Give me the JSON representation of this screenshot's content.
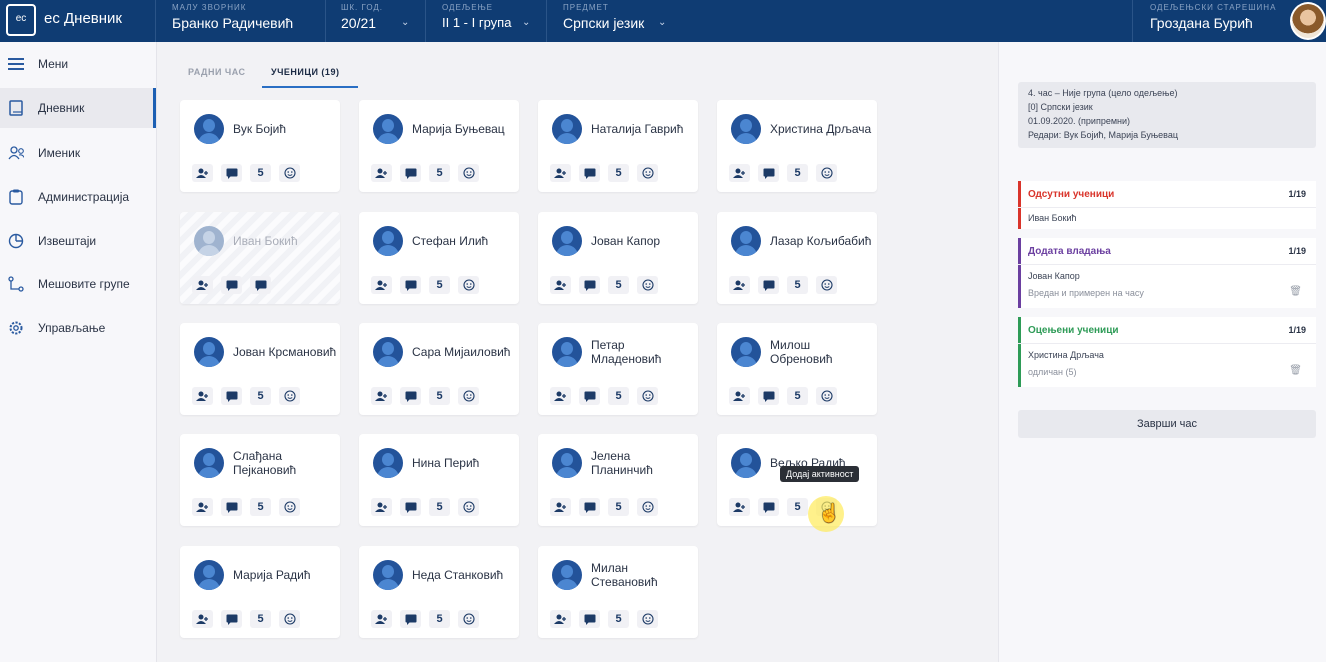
{
  "app": {
    "logo_text": "ес",
    "title": "ес Дневник"
  },
  "topbar": {
    "fields": [
      {
        "label": "малу зворник",
        "value": "Бранко Радичевић"
      },
      {
        "label": "шк. год.",
        "value": "20/21"
      },
      {
        "label": "одељење",
        "value": "II 1 - I група"
      },
      {
        "label": "предмет",
        "value": "Српски језик"
      }
    ],
    "teacher_label": "одељењски старешина",
    "teacher_name": "Гроздана Бурић"
  },
  "sidebar": {
    "items": [
      {
        "label": "Мени",
        "icon": "menu-icon"
      },
      {
        "label": "Дневник",
        "icon": "book-icon",
        "active": true
      },
      {
        "label": "Именик",
        "icon": "users-icon"
      },
      {
        "label": "Администрација",
        "icon": "clipboard-icon"
      },
      {
        "label": "Извештаји",
        "icon": "pie-chart-icon"
      },
      {
        "label": "Мешовите групе",
        "icon": "network-icon"
      },
      {
        "label": "Управљање",
        "icon": "gear-icon"
      }
    ]
  },
  "tabs": [
    {
      "label": "РАДНИ ЧАС",
      "active": false
    },
    {
      "label": "УЧЕНИЦИ (19)",
      "active": true
    }
  ],
  "students": [
    {
      "name": "Вук Бојић",
      "grade": "5"
    },
    {
      "name": "Марија Буњевац",
      "grade": "5"
    },
    {
      "name": "Наталија Гаврић",
      "grade": "5"
    },
    {
      "name": "Христина Дрљача",
      "grade": "5"
    },
    {
      "name": "Иван Бокић",
      "grade": "",
      "absent": true
    },
    {
      "name": "Стефан Илић",
      "grade": "5"
    },
    {
      "name": "Јован Капор",
      "grade": "5"
    },
    {
      "name": "Лазар Кољибабић",
      "grade": "5"
    },
    {
      "name": "Јован Крсмановић",
      "grade": "5"
    },
    {
      "name": "Сара Мијаиловић",
      "grade": "5"
    },
    {
      "name": "Петар Младеновић",
      "grade": "5"
    },
    {
      "name": "Милош Обреновић",
      "grade": "5"
    },
    {
      "name": "Слађана Пејкановић",
      "grade": "5"
    },
    {
      "name": "Нина Перић",
      "grade": "5"
    },
    {
      "name": "Јелена Планинчић",
      "grade": "5"
    },
    {
      "name": "Вељко Радић",
      "grade": "5"
    },
    {
      "name": "Марија Радић",
      "grade": "5"
    },
    {
      "name": "Неда Станковић",
      "grade": "5"
    },
    {
      "name": "Милан Стевановић",
      "grade": "5"
    }
  ],
  "tooltip": "Додај активност",
  "info": {
    "lines": [
      "4. час – Није група (цело одељење)",
      "[0] Српски језик",
      "01.09.2020. (припремни)",
      "Редари: Вук Бојић, Марија Буњевац"
    ]
  },
  "sections": {
    "absent": {
      "title": "Одсутни ученици",
      "count": "1/19",
      "color": "#d9342b",
      "item": "Иван Бокић"
    },
    "behavior": {
      "title": "Додата владања",
      "count": "1/19",
      "color": "#6b3fa0",
      "item": "Јован Капор",
      "sub": "Вредан и примерен на часу"
    },
    "graded": {
      "title": "Оцењени ученици",
      "count": "1/19",
      "color": "#2e9b57",
      "item": "Христина Дрљача",
      "sub": "одличан (5)"
    }
  },
  "end_button": "Заврши час"
}
